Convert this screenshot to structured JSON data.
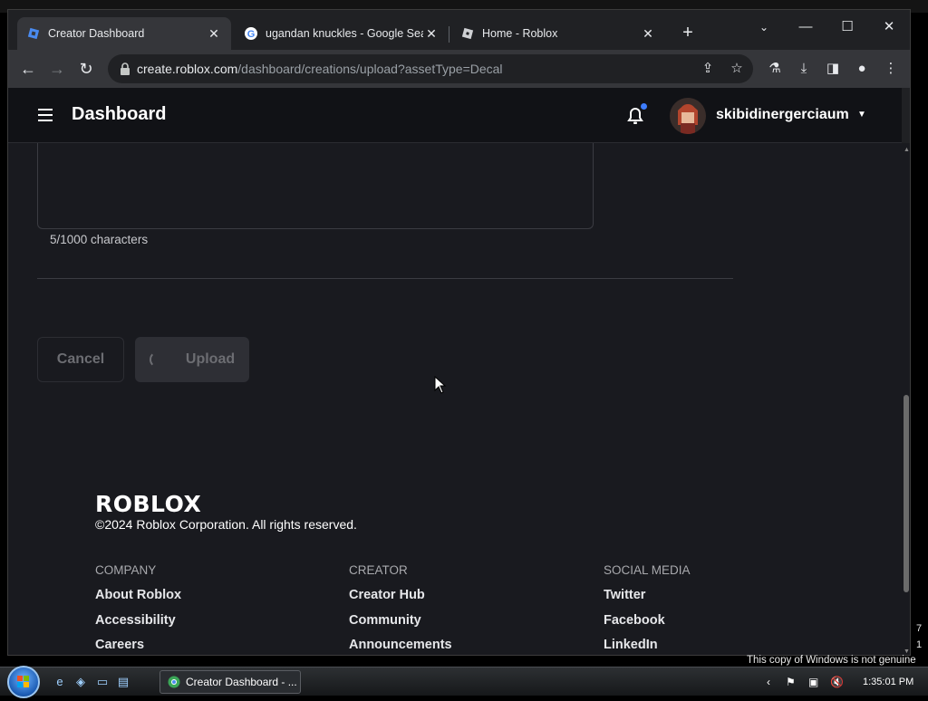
{
  "browser": {
    "tabs": [
      {
        "title": "Creator Dashboard",
        "active": true,
        "favicon": "roblox-studio-icon"
      },
      {
        "title": "ugandan knuckles - Google Sea",
        "active": false,
        "favicon": "google-icon"
      },
      {
        "title": "Home - Roblox",
        "active": false,
        "favicon": "roblox-icon"
      }
    ],
    "url_host": "create.roblox.com",
    "url_path": "/dashboard/creations/upload?assetType=Decal"
  },
  "header": {
    "title": "Dashboard",
    "username": "skibidinergerciaum",
    "notification_dot_color": "#3d7dff"
  },
  "form": {
    "char_count": "5/1000 characters",
    "cancel_label": "Cancel",
    "upload_label": "Upload"
  },
  "footer": {
    "logo": "ROBLOX",
    "copyright": "©2024 Roblox Corporation. All rights reserved.",
    "columns": [
      {
        "heading": "COMPANY",
        "links": [
          "About Roblox",
          "Accessibility",
          "Careers"
        ]
      },
      {
        "heading": "CREATOR",
        "links": [
          "Creator Hub",
          "Community",
          "Announcements"
        ]
      },
      {
        "heading": "SOCIAL MEDIA",
        "links": [
          "Twitter",
          "Facebook",
          "LinkedIn"
        ]
      }
    ]
  },
  "taskbar": {
    "task_label": "Creator Dashboard - ...",
    "clock": "1:35:01 PM",
    "watermark": "This copy of Windows is not genuine",
    "edge_digits": [
      "7",
      "1"
    ]
  }
}
